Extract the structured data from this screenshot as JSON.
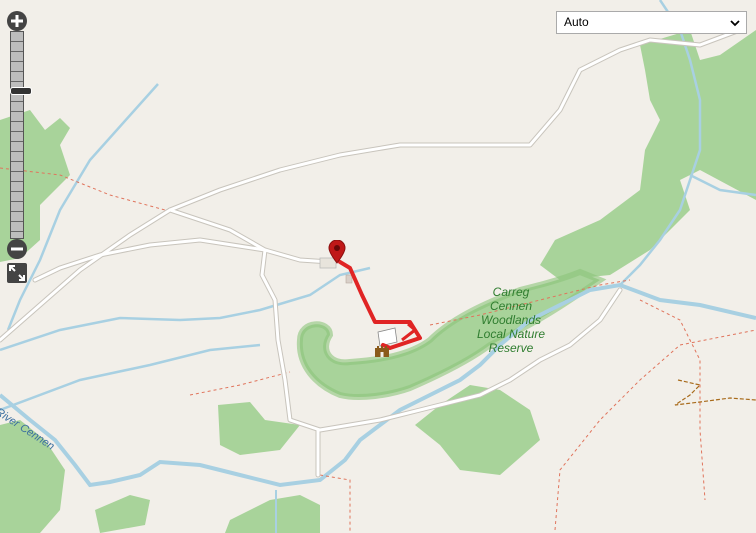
{
  "map": {
    "colors": {
      "background": "#f2efe9",
      "woodland": "#a8d39a",
      "woodland_edge": "#8cc47c",
      "water": "#a8d0e2",
      "road": "#ffffff",
      "road_casing": "#c8c4bc",
      "path": "#e0745c",
      "route": "#e02424",
      "marker": "#c01818",
      "bridleway": "#a86a1a"
    },
    "icons": {
      "marker": "map-pin-icon",
      "castle": "castle-icon",
      "tree": "tree-icon"
    }
  },
  "controls": {
    "zoom_in_symbol": "+",
    "zoom_out_symbol": "−",
    "zoom_level_fraction": 0.72,
    "fullscreen_icon": "expand-icon",
    "layer_select": {
      "selected": "Auto"
    }
  },
  "labels": {
    "reserve": [
      "Carreg",
      "Cennen",
      "Woodlands",
      "Local Nature",
      "Reserve"
    ],
    "river": "River Cennen"
  }
}
